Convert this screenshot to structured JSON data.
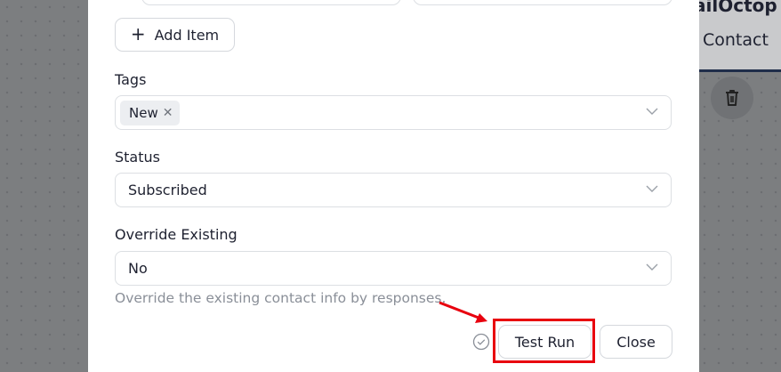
{
  "background": {
    "app_title": "ailOctop",
    "tab_label": "Contact",
    "trash_icon": "trash-icon"
  },
  "form": {
    "add_item_label": "Add Item",
    "tags": {
      "label": "Tags",
      "selected": [
        {
          "text": "New"
        }
      ]
    },
    "status": {
      "label": "Status",
      "value": "Subscribed"
    },
    "override_existing": {
      "label": "Override Existing",
      "value": "No",
      "hint": "Override the existing contact info by responses."
    }
  },
  "footer": {
    "test_run_label": "Test Run",
    "close_label": "Close",
    "status_icon": "check-circle-icon"
  },
  "colors": {
    "annotation_red": "#e8000e",
    "text_primary": "#1e2130",
    "hint_text": "#8a8f98"
  }
}
